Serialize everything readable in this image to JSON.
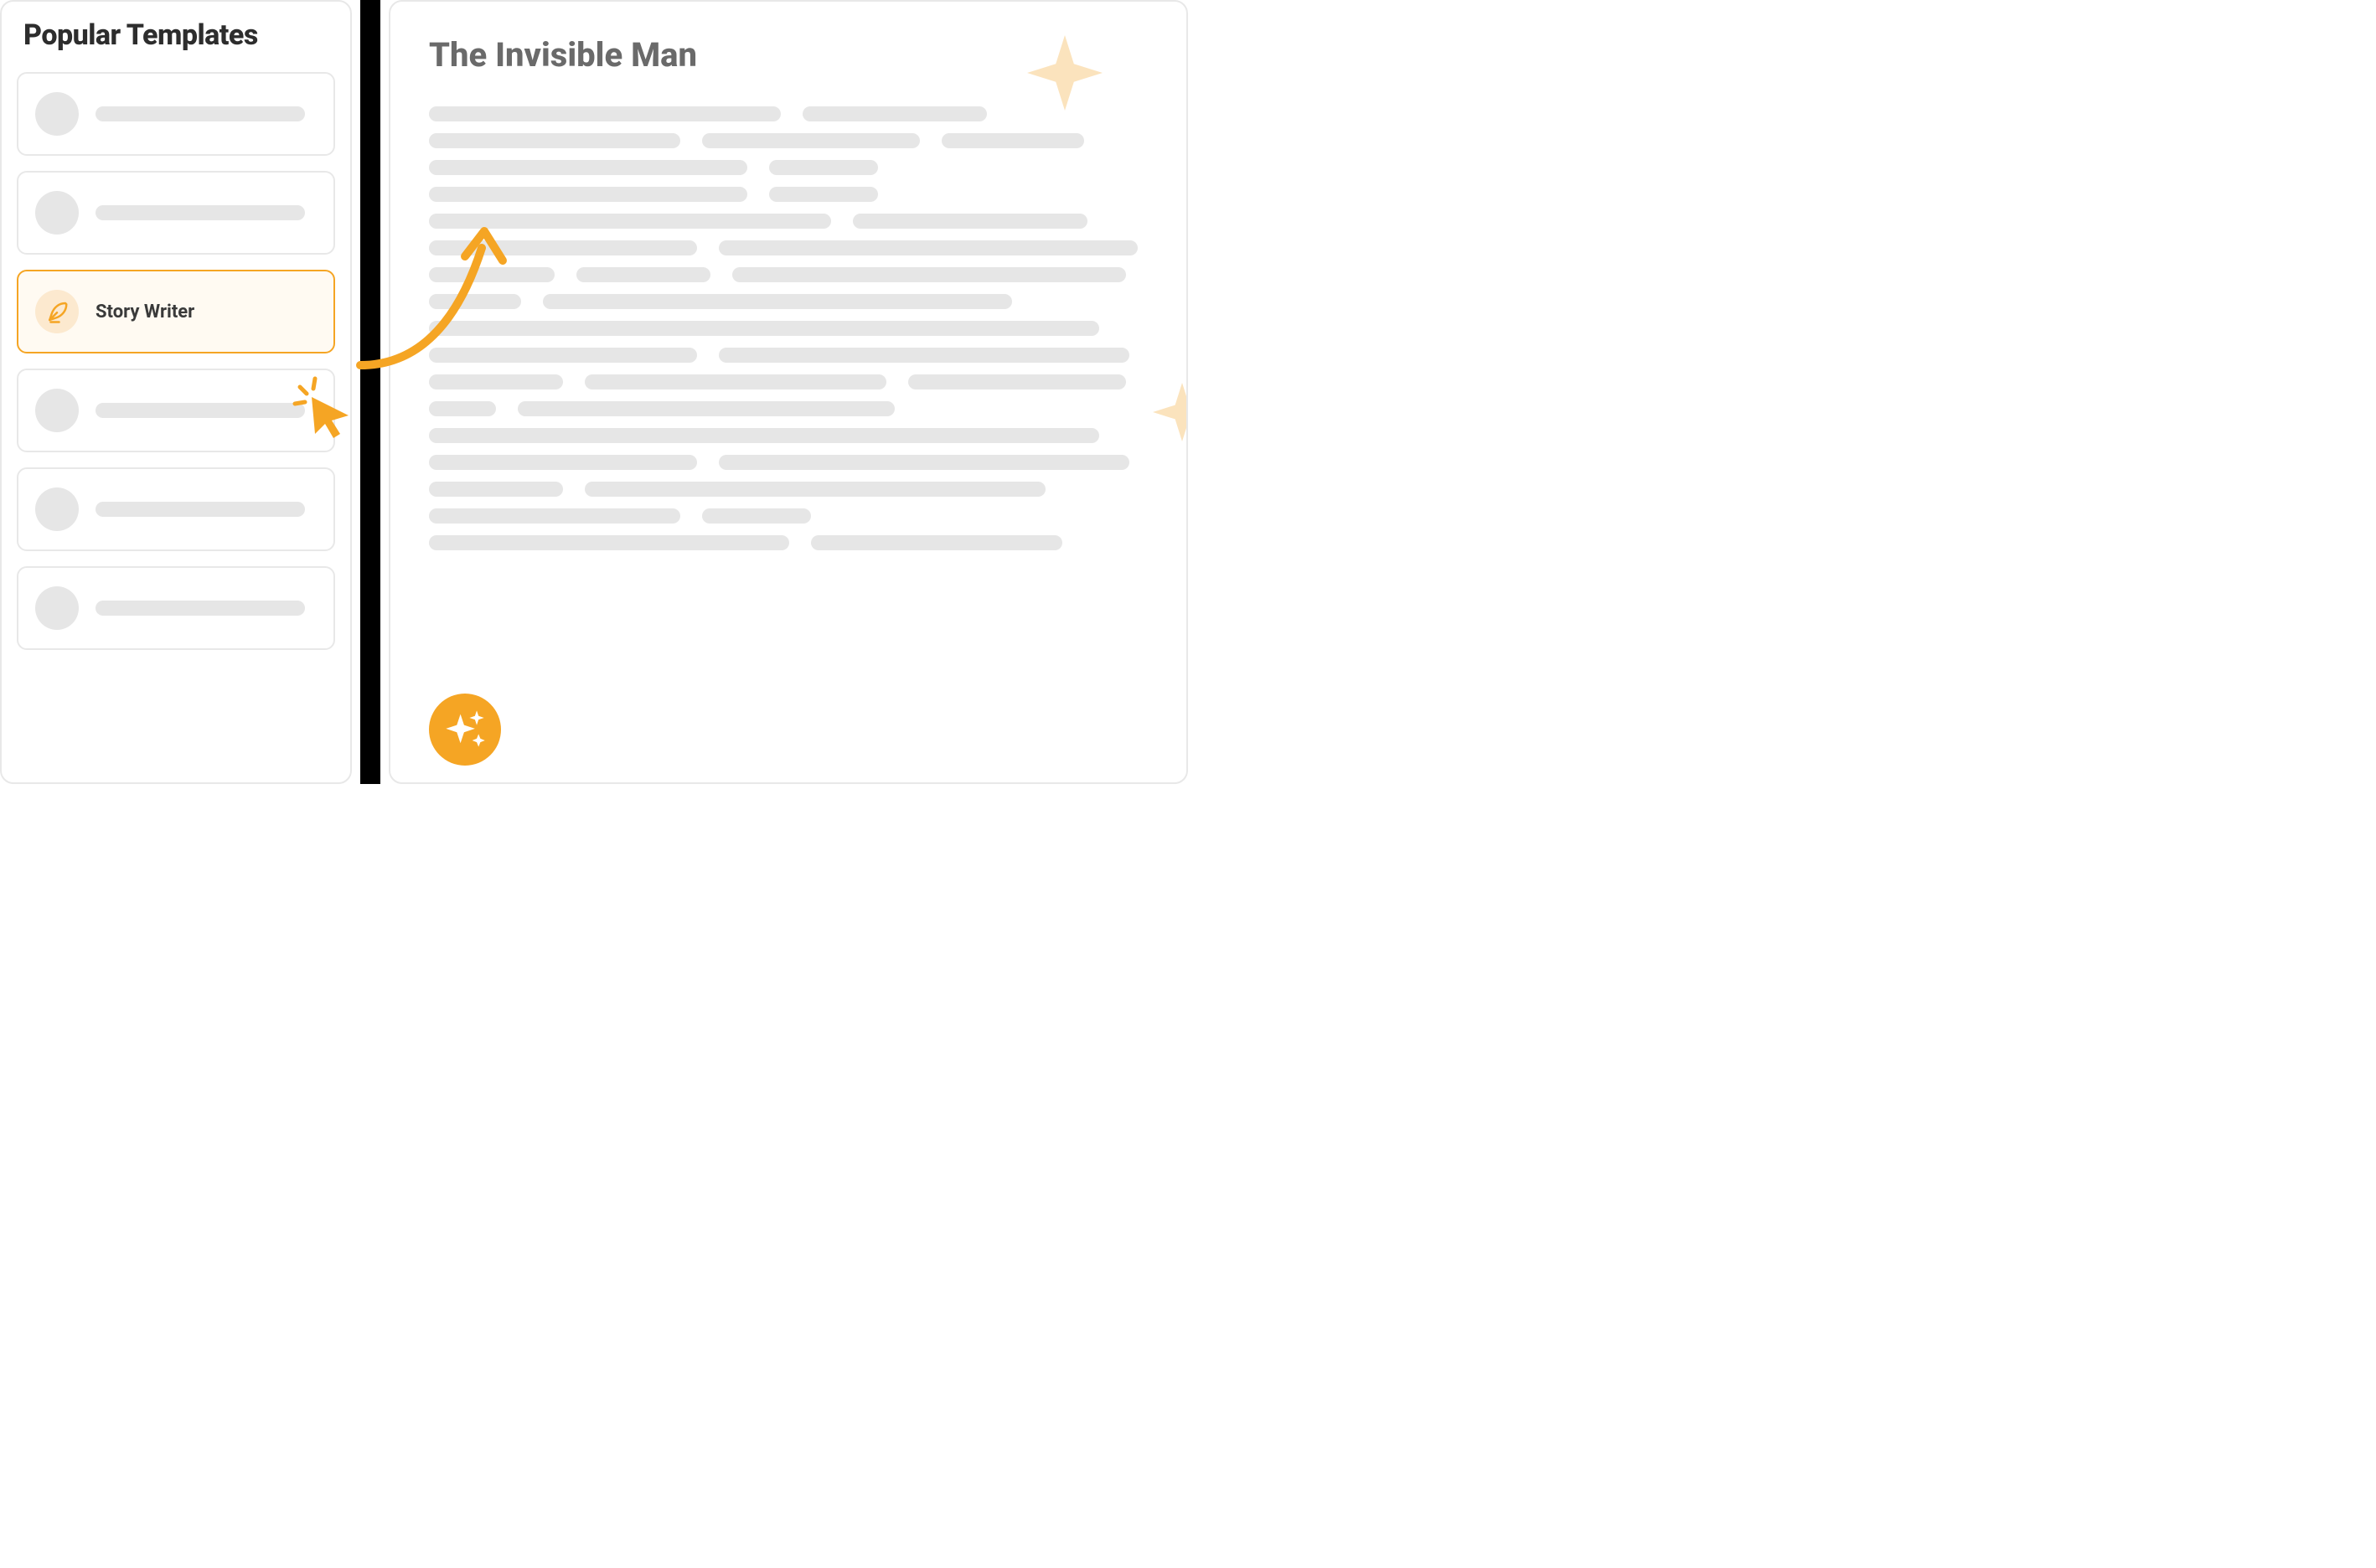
{
  "sidebar": {
    "title": "Popular Templates",
    "selected_index": 2,
    "selected_label": "Story Writer",
    "selected_icon": "quill-icon"
  },
  "document": {
    "title": "The Invisible Man"
  },
  "colors": {
    "accent": "#f5a524",
    "accent_light": "#fce9cf",
    "star_light": "#fbe3bd",
    "placeholder": "#e6e6e6",
    "text_dark": "#2d2d2d",
    "text_muted": "#6a6a6a"
  },
  "decorations": {
    "top_star": "sparkle-star-icon",
    "right_star": "sparkle-star-icon",
    "badge": "sparkles-icon",
    "cursor": "click-cursor-icon",
    "arrow": "curved-arrow-icon"
  },
  "placeholder_lines": [
    420,
    220,
    300,
    260,
    170,
    380,
    130,
    380,
    130,
    480,
    280,
    320,
    500,
    150,
    160,
    470,
    110,
    560,
    800,
    320,
    490,
    160,
    360,
    260,
    80,
    450,
    800,
    320,
    490,
    160,
    550,
    300,
    130,
    430,
    300
  ]
}
